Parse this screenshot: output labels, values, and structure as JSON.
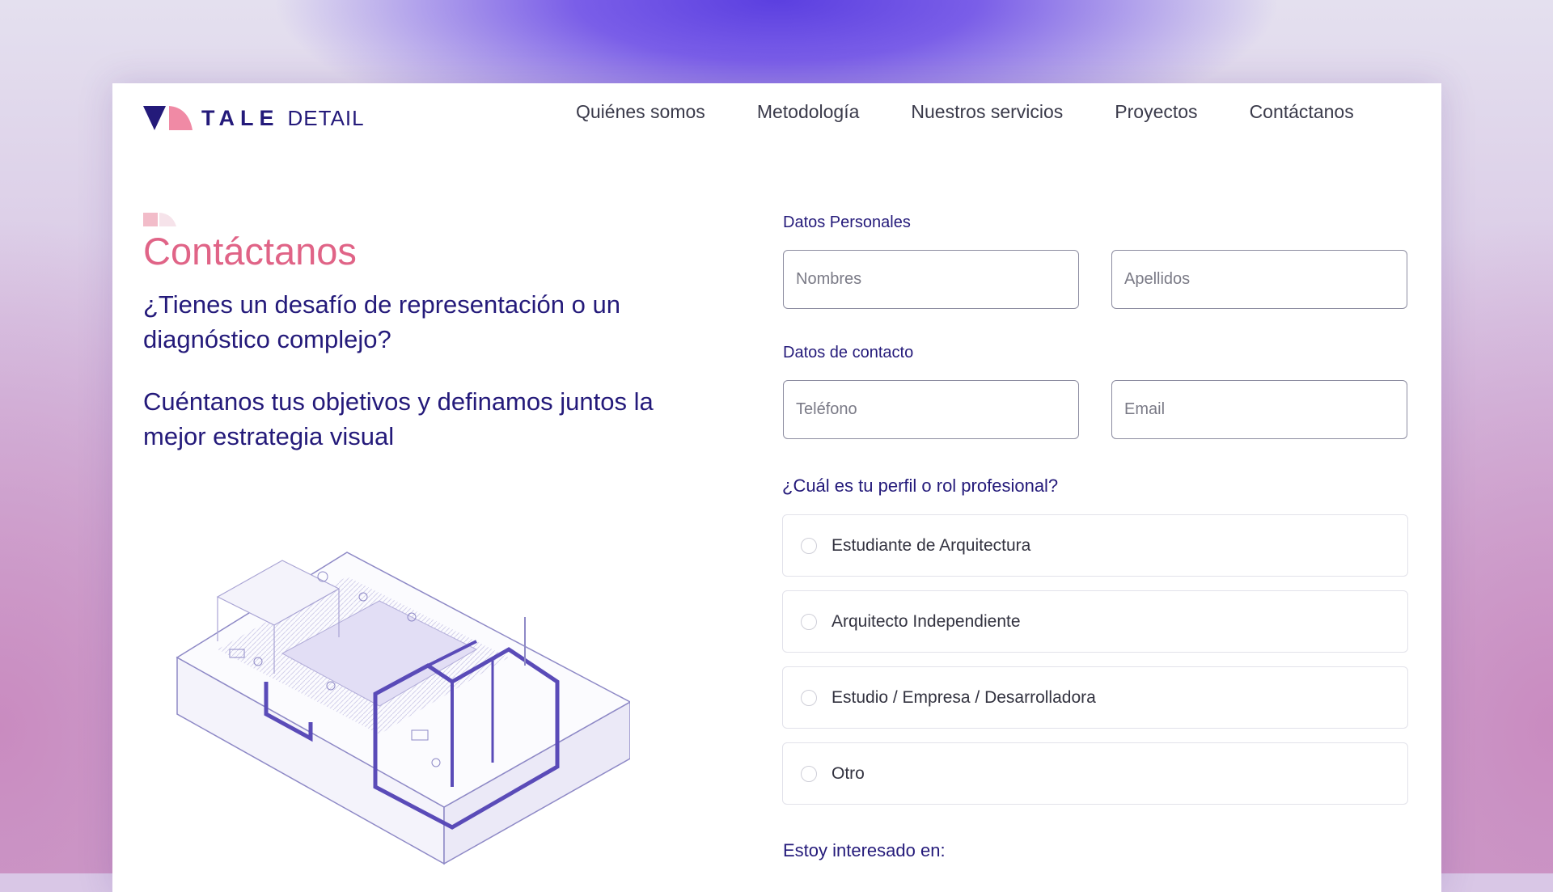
{
  "brand": {
    "name_bold": "TALE",
    "name_light": "DETAIL"
  },
  "nav": [
    {
      "label": "Quiénes somos"
    },
    {
      "label": "Metodología"
    },
    {
      "label": "Nuestros servicios"
    },
    {
      "label": "Proyectos"
    },
    {
      "label": "Contáctanos"
    }
  ],
  "hero": {
    "title": "Contáctanos",
    "question": "¿Tienes un desafío de representación o un diagnóstico complejo?",
    "subtitle": "Cuéntanos tus objetivos y definamos juntos la mejor estrategia visual"
  },
  "form": {
    "personal_label": "Datos Personales",
    "first_name_placeholder": "Nombres",
    "last_name_placeholder": "Apellidos",
    "contact_label": "Datos de contacto",
    "phone_placeholder": "Teléfono",
    "email_placeholder": "Email",
    "profile_question": "¿Cuál es tu perfil o rol profesional?",
    "profile_options": [
      {
        "label": "Estudiante de Arquitectura"
      },
      {
        "label": "Arquitecto Independiente"
      },
      {
        "label": "Estudio / Empresa / Desarrolladora"
      },
      {
        "label": "Otro"
      }
    ],
    "interest_label": "Estoy interesado en:"
  },
  "colors": {
    "accent_pink": "#e06487",
    "brand_navy": "#241a7a",
    "illustration_purple": "#5a4bb8"
  }
}
